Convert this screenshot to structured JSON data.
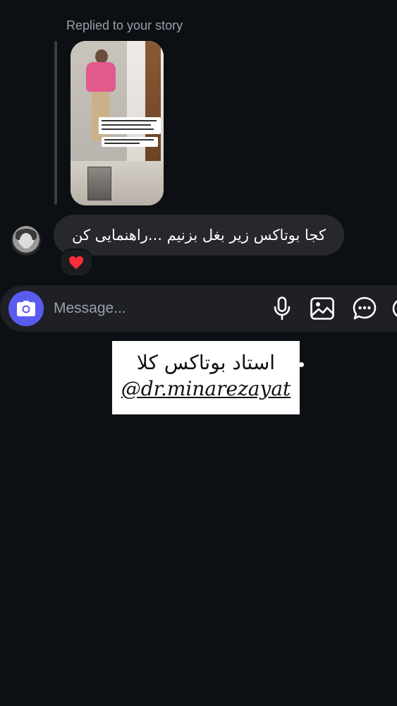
{
  "story_reply": {
    "label": "Replied to your story"
  },
  "message": {
    "text": "کجا بوتاکس زیر بغل بزنیم ...راهنمایی کن",
    "reaction": "❤️"
  },
  "composer": {
    "placeholder": "Message...",
    "camera_icon": "camera-icon",
    "icons": [
      "microphone-icon",
      "gallery-icon",
      "sticker-chat-icon"
    ]
  },
  "overlay": {
    "title": "استاد بوتاکس کلا",
    "handle": "@dr.minarezayat"
  },
  "colors": {
    "background": "#0c0f14",
    "bubble": "#26282c",
    "camera_button": "#5b5bf0",
    "muted_text": "#9aa0a8"
  }
}
